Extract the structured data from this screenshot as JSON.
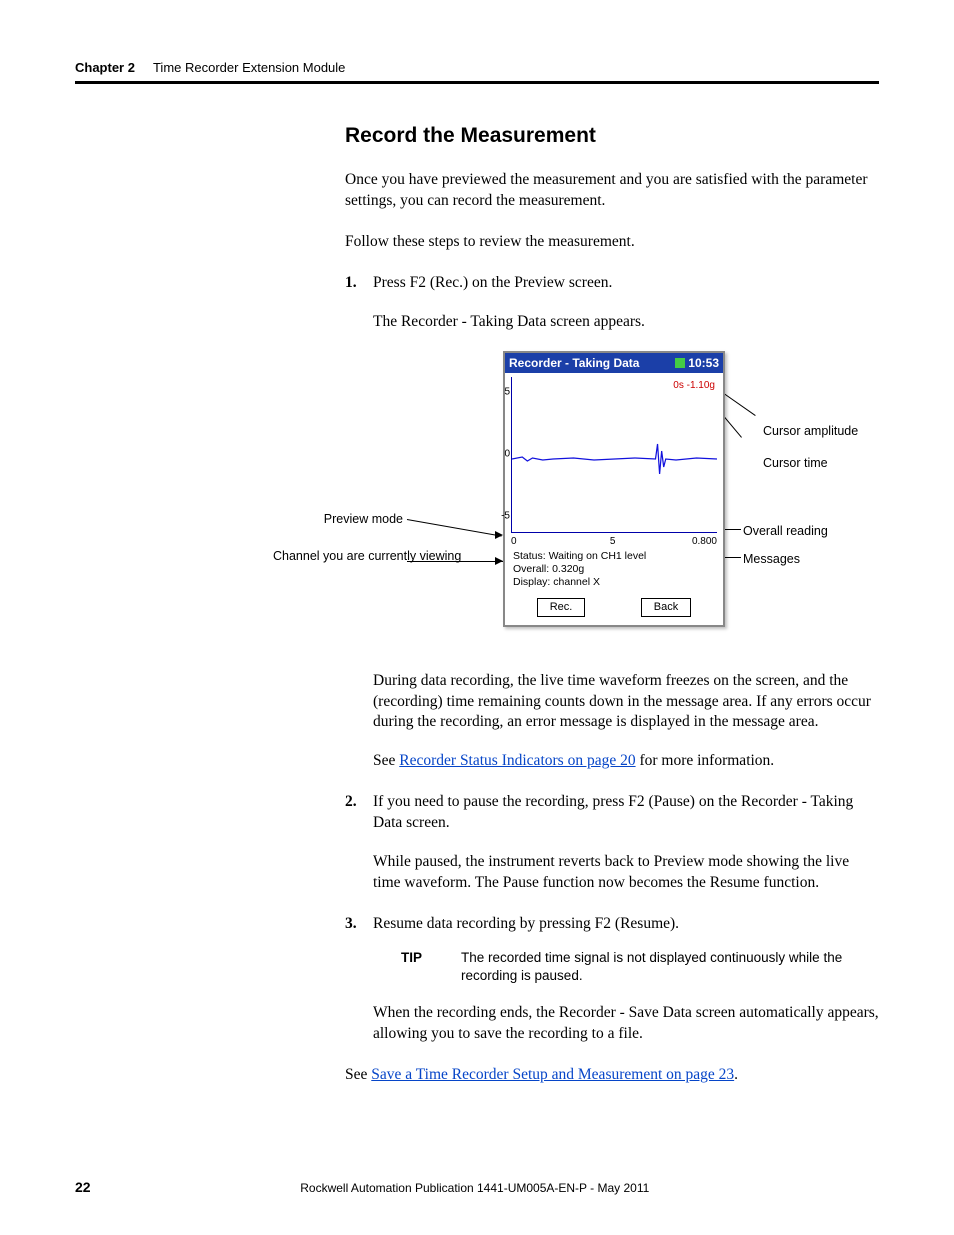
{
  "header": {
    "chapter": "Chapter 2",
    "title": "Time Recorder Extension Module"
  },
  "section_title": "Record the Measurement",
  "intro1": "Once you have previewed the measurement and you are satisfied with the parameter settings, you can record the measurement.",
  "intro2": "Follow these steps to review the measurement.",
  "steps": {
    "s1": "Press F2 (Rec.) on the Preview screen.",
    "s1_sub": "The Recorder - Taking Data screen appears.",
    "s1_para2": "During data recording, the live time waveform freezes on the screen, and the (recording) time remaining counts down in the message area. If any errors occur during the recording, an error message is displayed in the message area.",
    "s1_see_pre": "See ",
    "s1_link": "Recorder Status Indicators on page 20",
    "s1_see_post": " for more information.",
    "s2": "If you need to pause the recording, press F2 (Pause) on the Recorder - Taking Data screen.",
    "s2_sub": "While paused, the instrument reverts back to Preview mode showing the live time waveform. The Pause function now becomes the Resume function.",
    "s3": "Resume data recording by pressing F2 (Resume).",
    "s3_end": "When the recording ends, the Recorder - Save Data screen automatically appears, allowing you to save the recording to a file."
  },
  "tip": {
    "label": "TIP",
    "text": "The recorded time signal is not displayed continuously while the recording is paused."
  },
  "final_see_pre": "See ",
  "final_link": "Save a Time Recorder Setup and Measurement on page 23",
  "final_see_post": ".",
  "device": {
    "title": "Recorder - Taking Data",
    "time": "10:53",
    "cursor_readout": "0s   -1.10g",
    "status_line": "Status: Waiting on CH1 level",
    "overall_line": "Overall: 0.320g",
    "display_line": "Display: channel X",
    "btn_rec": "Rec.",
    "btn_back": "Back",
    "y_top": "5",
    "y_mid": "0",
    "y_bot": "-5",
    "x_zero": "0",
    "x_mid": "5",
    "x_end": "0.800"
  },
  "callouts": {
    "cursor_amp": "Cursor amplitude",
    "cursor_time": "Cursor time",
    "overall": "Overall reading",
    "messages": "Messages",
    "preview": "Preview mode",
    "channel": "Channel you are currently viewing"
  },
  "footer": {
    "page": "22",
    "pub": "Rockwell Automation Publication 1441-UM005A-EN-P - May 2011"
  },
  "chart_data": {
    "type": "line",
    "title": "Recorder - Taking Data",
    "xlabel": "",
    "ylabel": "",
    "ylim": [
      -5,
      5
    ],
    "xlim": [
      0,
      0.8
    ],
    "cursor": {
      "time_s": 0,
      "amplitude_g": -1.1
    },
    "overall_g": 0.32,
    "status": "Waiting on CH1 level",
    "display_channel": "X",
    "series": [
      {
        "name": "channel X",
        "description": "noisy waveform near 0 with spike ~0.6s",
        "values": []
      }
    ]
  }
}
